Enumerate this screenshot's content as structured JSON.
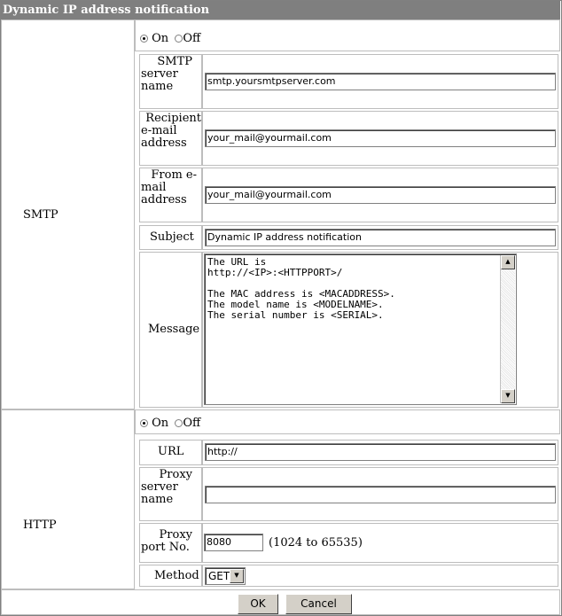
{
  "title": "Dynamic IP address notification",
  "smtp": {
    "section_label": "SMTP",
    "radio_on": "On",
    "radio_off": "Off",
    "server_label": "SMTP server name",
    "server_value": "smtp.yoursmtpserver.com",
    "recipient_label": "Recipient e-mail address",
    "recipient_value": "your_mail@yourmail.com",
    "from_label": "From e-mail address",
    "from_value": "your_mail@yourmail.com",
    "subject_label": "Subject",
    "subject_value": "Dynamic IP address notification",
    "message_label": "Message",
    "message_value": "The URL is\nhttp://<IP>:<HTTPPORT>/\n\nThe MAC address is <MACADDRESS>.\nThe model name is <MODELNAME>.\nThe serial number is <SERIAL>."
  },
  "http": {
    "section_label": "HTTP",
    "radio_on": "On",
    "radio_off": "Off",
    "url_label": "URL",
    "url_value": "http://",
    "proxy_name_label": "Proxy server name",
    "proxy_name_value": "",
    "proxy_port_label": "Proxy port No.",
    "proxy_port_value": "8080",
    "proxy_port_range": "(1024 to 65535)",
    "method_label": "Method",
    "method_value": "GET"
  },
  "buttons": {
    "ok": "OK",
    "cancel": "Cancel"
  }
}
